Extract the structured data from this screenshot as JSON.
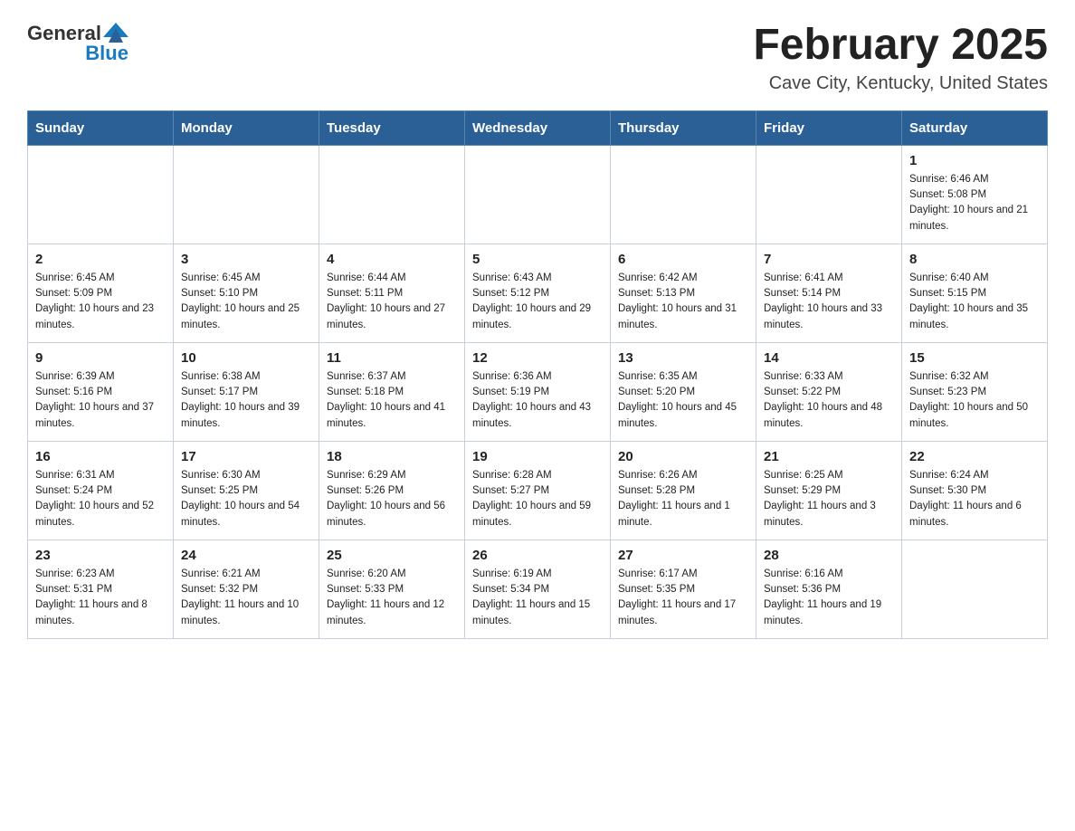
{
  "header": {
    "logo": {
      "text_general": "General",
      "text_blue": "Blue"
    },
    "title": "February 2025",
    "location": "Cave City, Kentucky, United States"
  },
  "days_of_week": [
    "Sunday",
    "Monday",
    "Tuesday",
    "Wednesday",
    "Thursday",
    "Friday",
    "Saturday"
  ],
  "weeks": [
    [
      {
        "day": "",
        "info": ""
      },
      {
        "day": "",
        "info": ""
      },
      {
        "day": "",
        "info": ""
      },
      {
        "day": "",
        "info": ""
      },
      {
        "day": "",
        "info": ""
      },
      {
        "day": "",
        "info": ""
      },
      {
        "day": "1",
        "info": "Sunrise: 6:46 AM\nSunset: 5:08 PM\nDaylight: 10 hours and 21 minutes."
      }
    ],
    [
      {
        "day": "2",
        "info": "Sunrise: 6:45 AM\nSunset: 5:09 PM\nDaylight: 10 hours and 23 minutes."
      },
      {
        "day": "3",
        "info": "Sunrise: 6:45 AM\nSunset: 5:10 PM\nDaylight: 10 hours and 25 minutes."
      },
      {
        "day": "4",
        "info": "Sunrise: 6:44 AM\nSunset: 5:11 PM\nDaylight: 10 hours and 27 minutes."
      },
      {
        "day": "5",
        "info": "Sunrise: 6:43 AM\nSunset: 5:12 PM\nDaylight: 10 hours and 29 minutes."
      },
      {
        "day": "6",
        "info": "Sunrise: 6:42 AM\nSunset: 5:13 PM\nDaylight: 10 hours and 31 minutes."
      },
      {
        "day": "7",
        "info": "Sunrise: 6:41 AM\nSunset: 5:14 PM\nDaylight: 10 hours and 33 minutes."
      },
      {
        "day": "8",
        "info": "Sunrise: 6:40 AM\nSunset: 5:15 PM\nDaylight: 10 hours and 35 minutes."
      }
    ],
    [
      {
        "day": "9",
        "info": "Sunrise: 6:39 AM\nSunset: 5:16 PM\nDaylight: 10 hours and 37 minutes."
      },
      {
        "day": "10",
        "info": "Sunrise: 6:38 AM\nSunset: 5:17 PM\nDaylight: 10 hours and 39 minutes."
      },
      {
        "day": "11",
        "info": "Sunrise: 6:37 AM\nSunset: 5:18 PM\nDaylight: 10 hours and 41 minutes."
      },
      {
        "day": "12",
        "info": "Sunrise: 6:36 AM\nSunset: 5:19 PM\nDaylight: 10 hours and 43 minutes."
      },
      {
        "day": "13",
        "info": "Sunrise: 6:35 AM\nSunset: 5:20 PM\nDaylight: 10 hours and 45 minutes."
      },
      {
        "day": "14",
        "info": "Sunrise: 6:33 AM\nSunset: 5:22 PM\nDaylight: 10 hours and 48 minutes."
      },
      {
        "day": "15",
        "info": "Sunrise: 6:32 AM\nSunset: 5:23 PM\nDaylight: 10 hours and 50 minutes."
      }
    ],
    [
      {
        "day": "16",
        "info": "Sunrise: 6:31 AM\nSunset: 5:24 PM\nDaylight: 10 hours and 52 minutes."
      },
      {
        "day": "17",
        "info": "Sunrise: 6:30 AM\nSunset: 5:25 PM\nDaylight: 10 hours and 54 minutes."
      },
      {
        "day": "18",
        "info": "Sunrise: 6:29 AM\nSunset: 5:26 PM\nDaylight: 10 hours and 56 minutes."
      },
      {
        "day": "19",
        "info": "Sunrise: 6:28 AM\nSunset: 5:27 PM\nDaylight: 10 hours and 59 minutes."
      },
      {
        "day": "20",
        "info": "Sunrise: 6:26 AM\nSunset: 5:28 PM\nDaylight: 11 hours and 1 minute."
      },
      {
        "day": "21",
        "info": "Sunrise: 6:25 AM\nSunset: 5:29 PM\nDaylight: 11 hours and 3 minutes."
      },
      {
        "day": "22",
        "info": "Sunrise: 6:24 AM\nSunset: 5:30 PM\nDaylight: 11 hours and 6 minutes."
      }
    ],
    [
      {
        "day": "23",
        "info": "Sunrise: 6:23 AM\nSunset: 5:31 PM\nDaylight: 11 hours and 8 minutes."
      },
      {
        "day": "24",
        "info": "Sunrise: 6:21 AM\nSunset: 5:32 PM\nDaylight: 11 hours and 10 minutes."
      },
      {
        "day": "25",
        "info": "Sunrise: 6:20 AM\nSunset: 5:33 PM\nDaylight: 11 hours and 12 minutes."
      },
      {
        "day": "26",
        "info": "Sunrise: 6:19 AM\nSunset: 5:34 PM\nDaylight: 11 hours and 15 minutes."
      },
      {
        "day": "27",
        "info": "Sunrise: 6:17 AM\nSunset: 5:35 PM\nDaylight: 11 hours and 17 minutes."
      },
      {
        "day": "28",
        "info": "Sunrise: 6:16 AM\nSunset: 5:36 PM\nDaylight: 11 hours and 19 minutes."
      },
      {
        "day": "",
        "info": ""
      }
    ]
  ]
}
